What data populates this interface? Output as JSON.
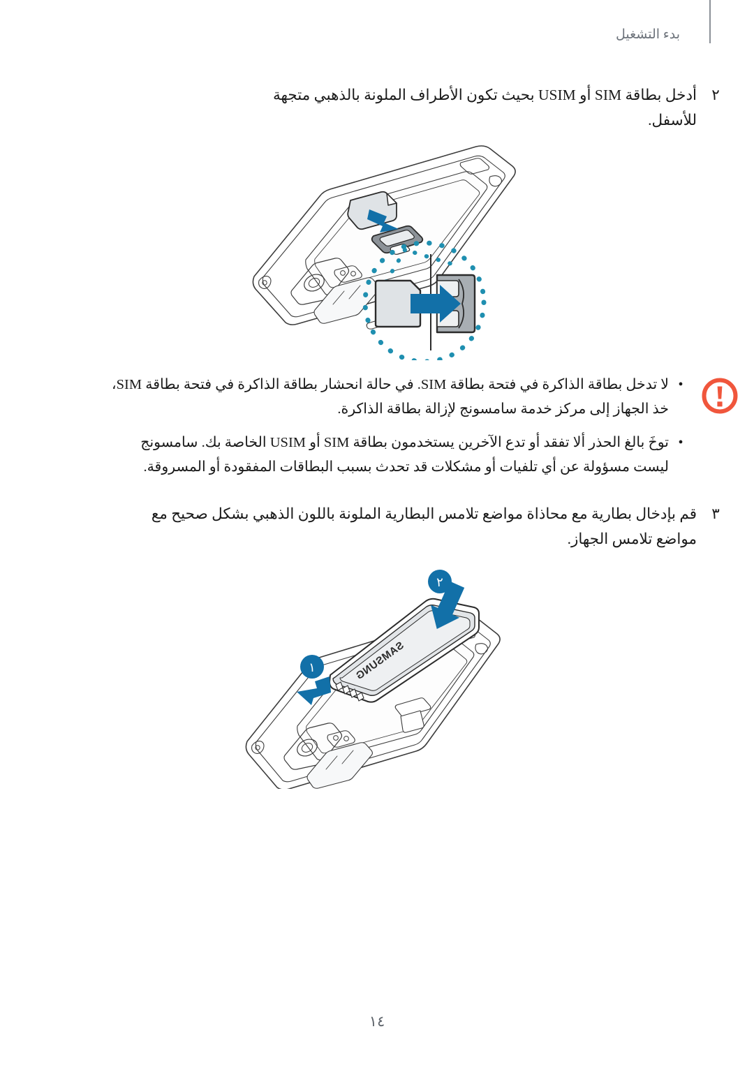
{
  "document": {
    "language": "ar",
    "direction": "rtl",
    "page_number": "١٤"
  },
  "header": {
    "title": "بدء التشغيل",
    "rule_color": "#8b9097",
    "title_color": "#6d737b"
  },
  "steps": [
    {
      "number": "٢",
      "text": "أدخل بطاقة SIM أو USIM بحيث تكون الأطراف الملونة بالذهبي متجهة للأسفل."
    },
    {
      "number": "٣",
      "text": "قم بإدخال بطارية مع محاذاة مواضع تلامس البطارية الملونة باللون الذهبي بشكل صحيح مع مواضع تلامس الجهاز."
    }
  ],
  "notice": {
    "icon": "warning-exclamation-icon",
    "icon_color": "#f0563c",
    "bullet_glyph": "•",
    "items": [
      "لا تدخل بطاقة الذاكرة في فتحة بطاقة SIM. في حالة انحشار بطاقة الذاكرة في فتحة بطاقة SIM، خذ الجهاز إلى مركز خدمة سامسونج لإزالة بطاقة الذاكرة.",
      "توخَ بالغ الحذر ألا تفقد أو تدع الآخرين يستخدمون بطاقة SIM أو USIM الخاصة بك. سامسونج ليست مسؤولة عن أي تلفيات أو مشكلات قد تحدث بسبب البطاقات المفقودة أو المسروقة."
    ]
  },
  "figures": [
    {
      "name": "sim-card-insertion-illustration",
      "caption": "",
      "callout_circle_color": "#1f8fb0",
      "arrow_color": "#1270a8",
      "device_line_color": "#3c3c3c",
      "detail_label": ""
    },
    {
      "name": "battery-insertion-illustration",
      "caption": "",
      "arrow_color": "#1270a8",
      "badge_color": "#1270a8",
      "badge_text_color": "#ffffff",
      "badges": [
        "١",
        "٢"
      ],
      "battery_brand": "SAMSUNG",
      "device_line_color": "#3c3c3c"
    }
  ],
  "colors": {
    "accent_blue": "#1270a8",
    "callout_teal": "#1f8fb0",
    "warning_orange": "#f0563c",
    "text": "#1a1a1a",
    "header_gray": "#6d737b",
    "shade_light": "#e4e7ea",
    "shade_mid": "#c8ccd0",
    "shade_dark": "#9aa0a6"
  }
}
